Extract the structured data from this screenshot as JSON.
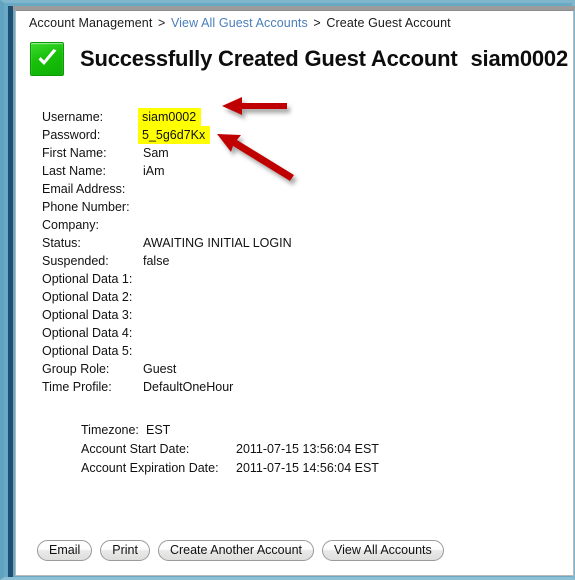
{
  "breadcrumb": {
    "root_label": "Account Management",
    "separator": ">",
    "link_label": "View All Guest Accounts",
    "current_label": "Create Guest Account"
  },
  "header": {
    "icon": "green-check-success-icon",
    "title": "Successfully Created Guest Account",
    "account_name": "siam0002",
    "icon_color": "#18c10a"
  },
  "details": {
    "highlight_color": "#ffff00",
    "rows": [
      {
        "label": "Username:",
        "value": "siam0002",
        "highlighted": true
      },
      {
        "label": "Password:",
        "value": "5_5g6d7Kx",
        "highlighted": true
      },
      {
        "label": "First Name:",
        "value": "Sam",
        "highlighted": false
      },
      {
        "label": "Last Name:",
        "value": "iAm",
        "highlighted": false
      },
      {
        "label": "Email Address:",
        "value": "",
        "highlighted": false
      },
      {
        "label": "Phone Number:",
        "value": "",
        "highlighted": false
      },
      {
        "label": "Company:",
        "value": "",
        "highlighted": false
      },
      {
        "label": "Status:",
        "value": "AWAITING INITIAL LOGIN",
        "highlighted": false
      },
      {
        "label": "Suspended:",
        "value": "false",
        "highlighted": false
      },
      {
        "label": "Optional Data 1:",
        "value": "",
        "highlighted": false
      },
      {
        "label": "Optional Data 2:",
        "value": "",
        "highlighted": false
      },
      {
        "label": "Optional Data 3:",
        "value": "",
        "highlighted": false
      },
      {
        "label": "Optional Data 4:",
        "value": "",
        "highlighted": false
      },
      {
        "label": "Optional Data 5:",
        "value": "",
        "highlighted": false
      },
      {
        "label": "Group Role:",
        "value": "Guest",
        "highlighted": false
      },
      {
        "label": "Time Profile:",
        "value": "DefaultOneHour",
        "highlighted": false
      }
    ]
  },
  "schedule": {
    "rows": [
      {
        "label": "Timezone:",
        "value": "EST"
      },
      {
        "label": "Account Start Date:",
        "value": "2011-07-15 13:56:04 EST"
      },
      {
        "label": "Account Expiration Date:",
        "value": "2011-07-15 14:56:04 EST"
      }
    ]
  },
  "buttons": [
    {
      "label": "Email"
    },
    {
      "label": "Print"
    },
    {
      "label": "Create Another Account"
    },
    {
      "label": "View All Accounts"
    }
  ],
  "annotations": {
    "arrow_color": "#c00000",
    "arrows": [
      {
        "name": "arrow-pointing-to-username",
        "target": "Username:"
      },
      {
        "name": "arrow-pointing-to-password",
        "target": "Password:"
      }
    ]
  }
}
